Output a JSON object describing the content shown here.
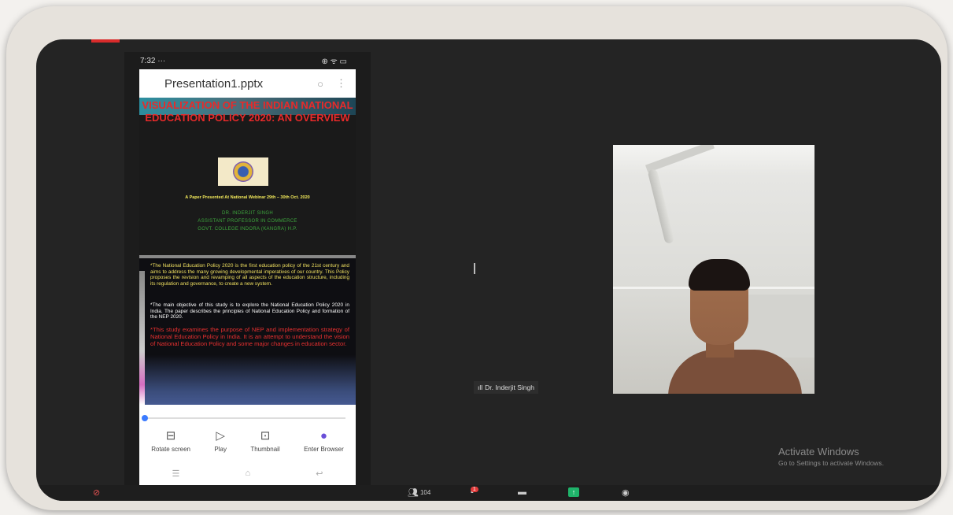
{
  "phone": {
    "time": "7:32 ···",
    "status_icons": "⊕ ᯤ ▭",
    "app_title": "Presentation1.pptx",
    "slide1": {
      "title": "VISUALIZATION OF THE INDIAN NATIONAL EDUCATION POLICY 2020: AN OVERVIEW",
      "paper_line": "A Paper Presented At National Webinar 29th – 30th Oct. 2020",
      "author_name": "DR. INDERJIT SINGH",
      "author_role": "ASSISTANT PROFESSOR IN COMMERCE",
      "author_college": "GOVT. COLLEGE INDORA (KANGRA) H.P."
    },
    "slide2": {
      "para1": "*The National Education Policy 2020 is the first education policy of the 21st century and aims to address the many growing developmental imperatives of our country. This Policy proposes the revision and revamping of all aspects of the education structure, including its regulation and governance, to create a new system.",
      "para2": "*The main objective of this study is to explore the National Education Policy 2020 in India. The paper describes the principles of National Education Policy and formation of the NEP 2020.",
      "para3": "*This study examines the purpose of NEP and implementation strategy of National Education Policy in India. It is an attempt to understand the vision of National Education Policy and some major changes in education sector."
    },
    "slider_progress": 0,
    "buttons": {
      "rotate": "Rotate screen",
      "play": "Play",
      "thumbnail": "Thumbnail",
      "browser": "Enter Browser"
    }
  },
  "participant_name": "Dr. Inderjit Singh",
  "watermark": {
    "line1": "Activate Windows",
    "line2": "Go to Settings to activate Windows."
  },
  "toolbar": {
    "participants_count": "104",
    "chat_badge": "1"
  },
  "colors": {
    "slide_title": "#e82a2a",
    "paper_line": "#f1e85a",
    "author": "#3da53d",
    "share_button": "#1fb36a",
    "record_tab": "#d92b2b"
  }
}
